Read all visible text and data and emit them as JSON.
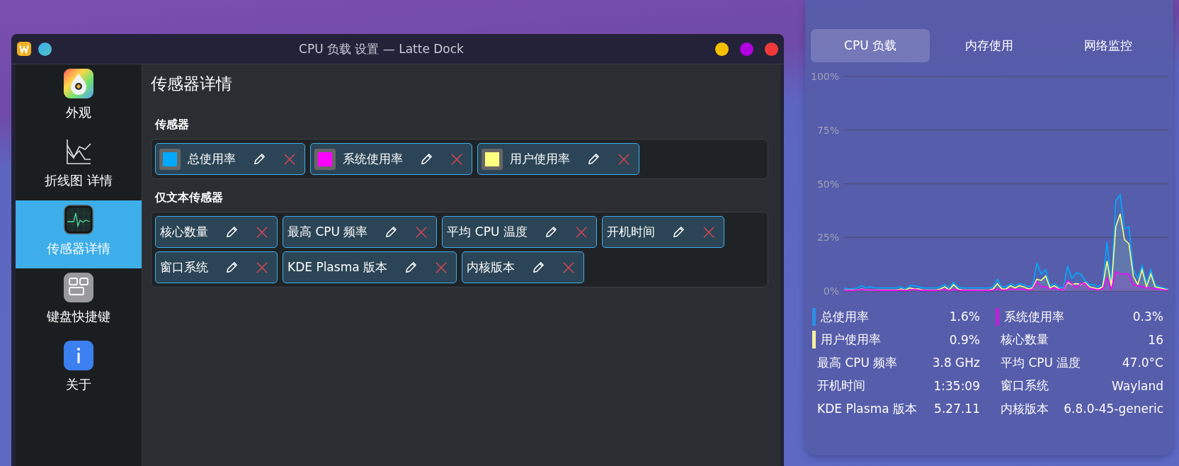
{
  "window": {
    "title": "CPU 负载 设置 — Latte Dock"
  },
  "sidebar": {
    "items": [
      {
        "label": "外观",
        "kind": "appearance",
        "selected": false
      },
      {
        "label": "折线图 详情",
        "kind": "chart",
        "selected": false
      },
      {
        "label": "传感器详情",
        "kind": "sensors",
        "selected": true
      },
      {
        "label": "键盘快捷键",
        "kind": "keyboard",
        "selected": false
      },
      {
        "label": "关于",
        "kind": "about",
        "selected": false
      }
    ]
  },
  "page": {
    "title": "传感器详情",
    "sections": [
      {
        "title": "传感器",
        "rows": [
          [
            {
              "label": "总使用率",
              "color": "#00aaff"
            },
            {
              "label": "系统使用率",
              "color": "#ff00ff"
            },
            {
              "label": "用户使用率",
              "color": "#ffff80"
            }
          ]
        ]
      },
      {
        "title": "仅文本传感器",
        "rows": [
          [
            {
              "label": "核心数量"
            },
            {
              "label": "最高 CPU 频率"
            },
            {
              "label": "平均 CPU 温度"
            },
            {
              "label": "开机时间"
            }
          ],
          [
            {
              "label": "窗口系统"
            },
            {
              "label": "KDE Plasma 版本"
            },
            {
              "label": "内核版本"
            }
          ]
        ]
      }
    ]
  },
  "widget": {
    "tabs": [
      {
        "label": "CPU 负载",
        "selected": true
      },
      {
        "label": "内存使用",
        "selected": false
      },
      {
        "label": "网络监控",
        "selected": false
      }
    ],
    "chart_data": {
      "type": "area",
      "yticks": [
        {
          "value": 0,
          "label": "0%"
        },
        {
          "value": 25,
          "label": "25%"
        },
        {
          "value": 50,
          "label": "50%"
        },
        {
          "value": 75,
          "label": "75%"
        },
        {
          "value": 100,
          "label": "100%"
        }
      ],
      "ylim": [
        0,
        100
      ],
      "grid": true,
      "series": [
        {
          "color": "#00aaff",
          "values": [
            1.5,
            1,
            1,
            1.5,
            2.5,
            1.5,
            2,
            1.5,
            1.5,
            1.5,
            1.5,
            1.5,
            1.5,
            2,
            1,
            2.5,
            2.5,
            2,
            1.5,
            1.5,
            1.5,
            1.5,
            2,
            3,
            1.5,
            4,
            2,
            1.5,
            1.5,
            1.5,
            1.5,
            1.5,
            1.5,
            1.5,
            2,
            5.5,
            2,
            2,
            3.5,
            2.5,
            3.5,
            3,
            2,
            2.5,
            13,
            8,
            10,
            2.5,
            3.5,
            2,
            1.5,
            11.5,
            6,
            8.5,
            8,
            5,
            3,
            3,
            2,
            3,
            23,
            3,
            42,
            45,
            29,
            30,
            10,
            6,
            12,
            4,
            10,
            3,
            2,
            1.5,
            1
          ]
        },
        {
          "color": "#ffff80",
          "values": [
            0.5,
            0.5,
            0.5,
            0.5,
            1,
            0.5,
            0.5,
            0.5,
            0.5,
            0.5,
            0.5,
            0.5,
            0.5,
            1,
            0.5,
            1.5,
            1,
            1,
            0.5,
            0.5,
            0.5,
            0.5,
            1,
            2,
            0.5,
            3,
            1,
            0.5,
            0.5,
            0.5,
            0.5,
            0.5,
            0.5,
            0.5,
            1,
            3.5,
            1,
            1,
            2.5,
            1.5,
            2.5,
            2,
            1,
            1.5,
            5.5,
            5,
            7,
            1.5,
            2.5,
            1,
            0.5,
            4,
            3,
            3.5,
            3,
            4,
            2,
            1.5,
            1,
            2,
            14,
            2,
            30,
            36,
            24,
            22,
            7,
            3,
            10,
            2,
            8,
            2,
            1.5,
            1,
            0.5
          ]
        },
        {
          "color": "#ff00ff",
          "values": [
            0.3,
            0.3,
            0.3,
            0.5,
            0.8,
            0.5,
            0.5,
            0.5,
            0.3,
            0.3,
            0.3,
            0.3,
            0.3,
            0.5,
            0.3,
            0.5,
            0.8,
            0.5,
            0.3,
            0.3,
            0.3,
            0.3,
            0.5,
            0.8,
            0.3,
            0.8,
            0.5,
            0.3,
            0.3,
            0.3,
            0.3,
            0.3,
            0.3,
            0.3,
            0.5,
            1,
            0.5,
            0.5,
            1,
            0.8,
            1,
            0.8,
            0.5,
            0.8,
            4.5,
            2,
            2,
            1,
            1.5,
            0.8,
            0.5,
            5,
            3.5,
            1.5,
            3.5,
            3.5,
            1,
            1,
            0.5,
            1,
            6,
            1,
            9,
            8,
            8,
            8,
            3,
            2.5,
            2,
            1.5,
            1.5,
            1,
            1,
            0.5,
            0.5
          ]
        }
      ]
    },
    "legend": [
      {
        "label": "总使用率",
        "value": "1.6%",
        "color": "#2b8fe6"
      },
      {
        "label": "系统使用率",
        "value": "0.3%",
        "color": "#c21fd6"
      },
      {
        "label": "用户使用率",
        "value": "0.9%",
        "color": "#f8f0a0"
      },
      {
        "label": "核心数量",
        "value": "16"
      },
      {
        "label": "最高 CPU 频率",
        "value": "3.8 GHz"
      },
      {
        "label": "平均 CPU 温度",
        "value": "47.0°C"
      },
      {
        "label": "开机时间",
        "value": "1:35:09"
      },
      {
        "label": "窗口系统",
        "value": "Wayland"
      },
      {
        "label": "KDE Plasma 版本",
        "value": "5.27.11"
      },
      {
        "label": "内核版本",
        "value": "6.8.0-45-generic"
      }
    ]
  }
}
